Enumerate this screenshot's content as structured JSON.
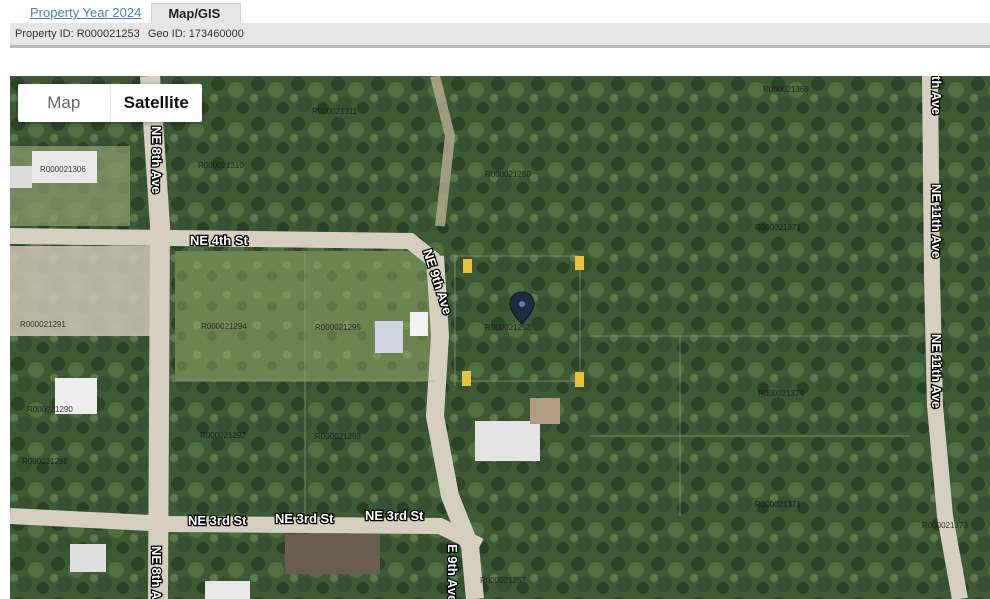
{
  "tabs": {
    "property_year": "Property Year 2024",
    "map_gis": "Map/GIS"
  },
  "info": {
    "property_id": "Property ID:  R000021253",
    "geo_id": "Geo ID:  173460000"
  },
  "map_type": {
    "map_label": "Map",
    "satellite_label": "Satellite"
  },
  "streets": {
    "ne_4th_st": "NE 4th St",
    "ne_3rd_st_1": "NE 3rd St",
    "ne_3rd_st_2": "NE 3rd St",
    "ne_3rd_st_3": "NE 3rd St",
    "ne_8th_ave_top": "NE 8th Ave",
    "ne_8th_ave_bottom": "NE 8th A",
    "ne_9th_ave_top": "NE 9th Ave",
    "ne_9th_ave_bottom": "E 9th Ave",
    "ne_11th_ave_1": "NE 11th Ave",
    "ne_11th_ave_2": "NE 11th Ave",
    "ne_11th_ave_top": "th Ave"
  },
  "parcels": {
    "p1": "R000021311",
    "p2": "R000021306",
    "p3": "R000021310",
    "p4": "R000021250",
    "p5": "R000021371",
    "p6": "R000021369",
    "p7": "R000021253",
    "p8": "R000021294",
    "p9": "R000021295",
    "p10": "R000021291",
    "p11": "R000021290",
    "p12": "R000021292",
    "p13": "R000021293",
    "p14": "R000021288",
    "p15": "R000021374",
    "p16": "R000021371",
    "p17": "R000021373",
    "p18": "R000021257"
  },
  "colors": {
    "tree_dark": "#2f4a2a",
    "tree_mid": "#4a6a3d",
    "grass": "#6f8a55",
    "road": "#d8d2c6",
    "marker": "#1d2d44",
    "corner": "#e8c23a"
  },
  "icons": {
    "marker": "map-pin-icon"
  }
}
